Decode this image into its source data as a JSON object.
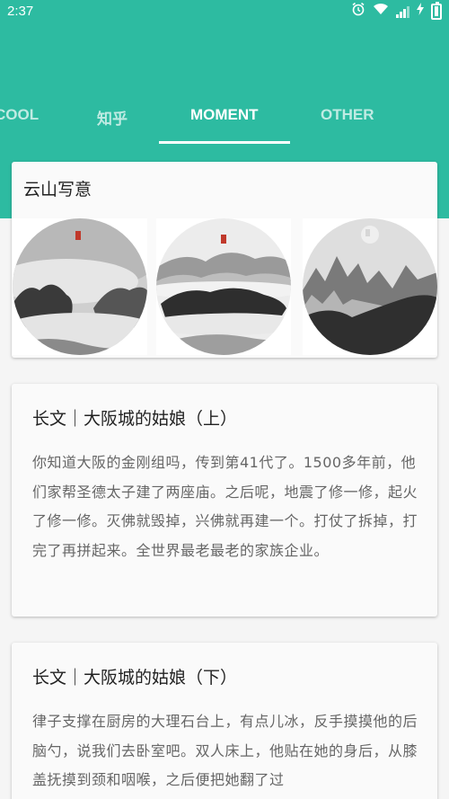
{
  "status_bar": {
    "time": "2:37",
    "icons": [
      "alarm-icon",
      "wifi-icon",
      "signal-icon",
      "charging-icon",
      "battery-icon"
    ]
  },
  "colors": {
    "primary": "#2dbba1",
    "background": "#f5f5f5",
    "card": "#fafafa"
  },
  "tabs": {
    "items": [
      {
        "label": "COOL",
        "active": false
      },
      {
        "label": "知乎",
        "active": false
      },
      {
        "label": "MOMENT",
        "active": true
      },
      {
        "label": "OTHER",
        "active": false
      }
    ]
  },
  "gallery_card": {
    "title": "云山写意",
    "images": [
      "ink-landscape-mist-trees",
      "ink-landscape-valley-clouds",
      "ink-landscape-peaks"
    ]
  },
  "posts": [
    {
      "title": "长文｜大阪城的姑娘（上）",
      "body": "你知道大阪的金刚组吗，传到第41代了。1500多年前，他们家帮圣德太子建了两座庙。之后呢，地震了修一修，起火了修一修。灭佛就毁掉，兴佛就再建一个。打仗了拆掉，打完了再拼起来。全世界最老最老的家族企业。"
    },
    {
      "title": "长文｜大阪城的姑娘（下）",
      "body": "律子支撑在厨房的大理石台上，有点儿冰，反手摸摸他的后脑勺，说我们去卧室吧。双人床上，他贴在她的身后，从膝盖抚摸到颈和咽喉，之后便把她翻了过"
    }
  ]
}
